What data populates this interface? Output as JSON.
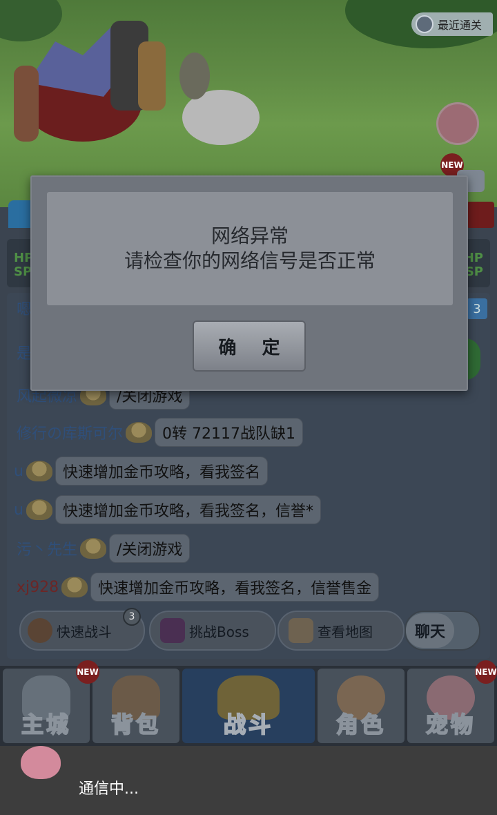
{
  "top_bar": {
    "last_stage_label": "最近通关"
  },
  "badges": {
    "new": "NEW",
    "quick_battle_count": "3"
  },
  "status": {
    "hp_left": "HP",
    "sp_left": "SP",
    "hp_right": "HP",
    "sp_right": "SP"
  },
  "chat": {
    "side_tab": "3",
    "partial_row_1": "嗯",
    "partial_row_2": "是",
    "rows": [
      {
        "name": "风起微凉",
        "message": "/关闭游戏"
      },
      {
        "name": "修行の库斯可尔",
        "message": "0转  72117战队缺1"
      },
      {
        "name": "u",
        "message": "快速增加金币攻略，看我签名"
      },
      {
        "name": "u",
        "message": "快速增加金币攻略，看我签名，信誉*"
      },
      {
        "name": "污丶先生",
        "message": "/关闭游戏"
      },
      {
        "name": "xj928",
        "message": "快速增加金币攻略，看我签名，信誉售金"
      }
    ]
  },
  "actions": {
    "quick_battle": "快速战斗",
    "boss": "挑战Boss",
    "map": "查看地图",
    "chat_toggle": "聊天"
  },
  "nav": [
    {
      "label": "主城"
    },
    {
      "label": "背包"
    },
    {
      "label": "战斗"
    },
    {
      "label": "角色"
    },
    {
      "label": "宠物"
    }
  ],
  "dialog": {
    "title": "网络异常",
    "message": "请检查你的网络信号是否正常",
    "confirm": "确 定"
  },
  "toast": {
    "text": "通信中..."
  }
}
